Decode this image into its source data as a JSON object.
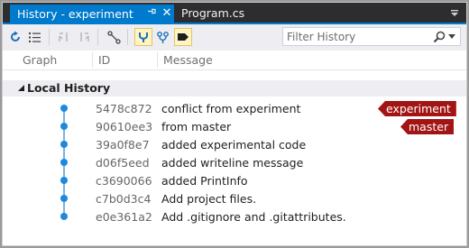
{
  "tabs": {
    "active": {
      "label": "History - experiment",
      "pin_glyph": "⍂",
      "close_glyph": "✕"
    },
    "inactive": {
      "label": "Program.cs"
    }
  },
  "toolbar": {
    "filter": {
      "placeholder": "Filter History",
      "value": ""
    }
  },
  "columns": {
    "graph": "Graph",
    "id": "ID",
    "message": "Message"
  },
  "group": {
    "label": "Local History"
  },
  "commits": [
    {
      "id": "5478c872",
      "message": "conflict from experiment",
      "tag": "experiment"
    },
    {
      "id": "90610ee3",
      "message": "from master",
      "tag": "master"
    },
    {
      "id": "39a0f8e7",
      "message": "added experimental code",
      "tag": ""
    },
    {
      "id": "d06f5eed",
      "message": "added writeline message",
      "tag": ""
    },
    {
      "id": "c3690066",
      "message": "added PrintInfo",
      "tag": ""
    },
    {
      "id": "c7b0d3c4",
      "message": "Add project files.",
      "tag": ""
    },
    {
      "id": "e0e361a2",
      "message": "Add .gitignore and .gitattributes.",
      "tag": ""
    }
  ],
  "colors": {
    "tab_accent": "#007acc",
    "graph_node": "#1e88dd",
    "branch_badge": "#a31515"
  },
  "icons": [
    "refresh-icon",
    "list-view-icon",
    "previous-icon",
    "next-icon",
    "branch-icon",
    "show-branches-icon",
    "remote-branches-icon",
    "tags-icon",
    "search-icon",
    "dropdown-icon"
  ]
}
